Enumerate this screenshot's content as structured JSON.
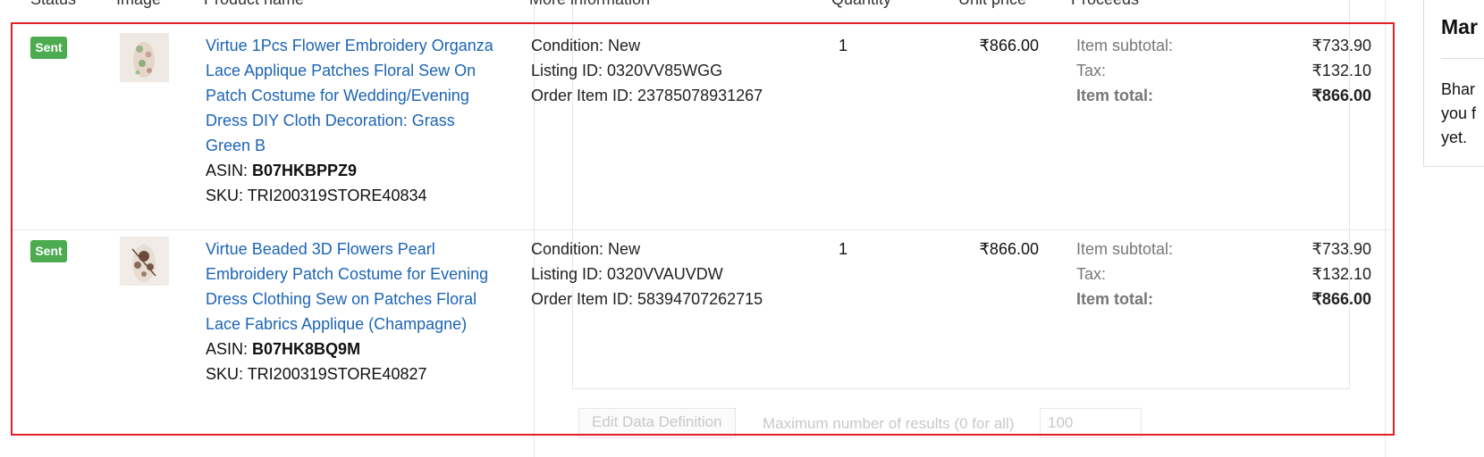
{
  "header": {
    "status": "Status",
    "image": "Image",
    "product_name": "Product name",
    "more_information": "More information",
    "quantity": "Quantity",
    "unit_price": "Unit price",
    "proceeds": "Proceeds"
  },
  "background": {
    "edit_button": "Edit Data Definition",
    "max_results_label": "Maximum number of results (0 for all)",
    "max_results_value": "100"
  },
  "rows": [
    {
      "status": "Sent",
      "title": "Virtue 1Pcs Flower Embroidery Organza Lace Applique Patches Floral Sew On Patch Costume for Wedding/Evening Dress DIY Cloth Decoration: Grass Green B",
      "asin_label": "ASIN:",
      "asin": "B07HKBPPZ9",
      "sku": "SKU: TRI200319STORE40834",
      "condition": "Condition: New",
      "listing_id": "Listing ID: 0320VV85WGG",
      "order_item_id": "Order Item ID: 23785078931267",
      "quantity": "1",
      "unit_price": "₹866.00",
      "subtotal_label": "Item subtotal:",
      "subtotal": "₹733.90",
      "tax_label": "Tax:",
      "tax": "₹132.10",
      "total_label": "Item total:",
      "total": "₹866.00"
    },
    {
      "status": "Sent",
      "title": "Virtue Beaded 3D Flowers Pearl Embroidery Patch Costume for Evening Dress Clothing Sew on Patches Floral Lace Fabrics Applique (Champagne)",
      "asin_label": "ASIN:",
      "asin": "B07HK8BQ9M",
      "sku": "SKU: TRI200319STORE40827",
      "condition": "Condition: New",
      "listing_id": "Listing ID: 0320VVAUVDW",
      "order_item_id": "Order Item ID: 58394707262715",
      "quantity": "1",
      "unit_price": "₹866.00",
      "subtotal_label": "Item subtotal:",
      "subtotal": "₹733.90",
      "tax_label": "Tax:",
      "tax": "₹132.10",
      "total_label": "Item total:",
      "total": "₹866.00"
    }
  ],
  "side_panel": {
    "title": "Mar",
    "text_lines": [
      "Bhar",
      "you f",
      "yet."
    ]
  },
  "colors": {
    "link": "#1c64b5",
    "badge": "#4bab4e",
    "highlight_border": "#e41e26"
  }
}
